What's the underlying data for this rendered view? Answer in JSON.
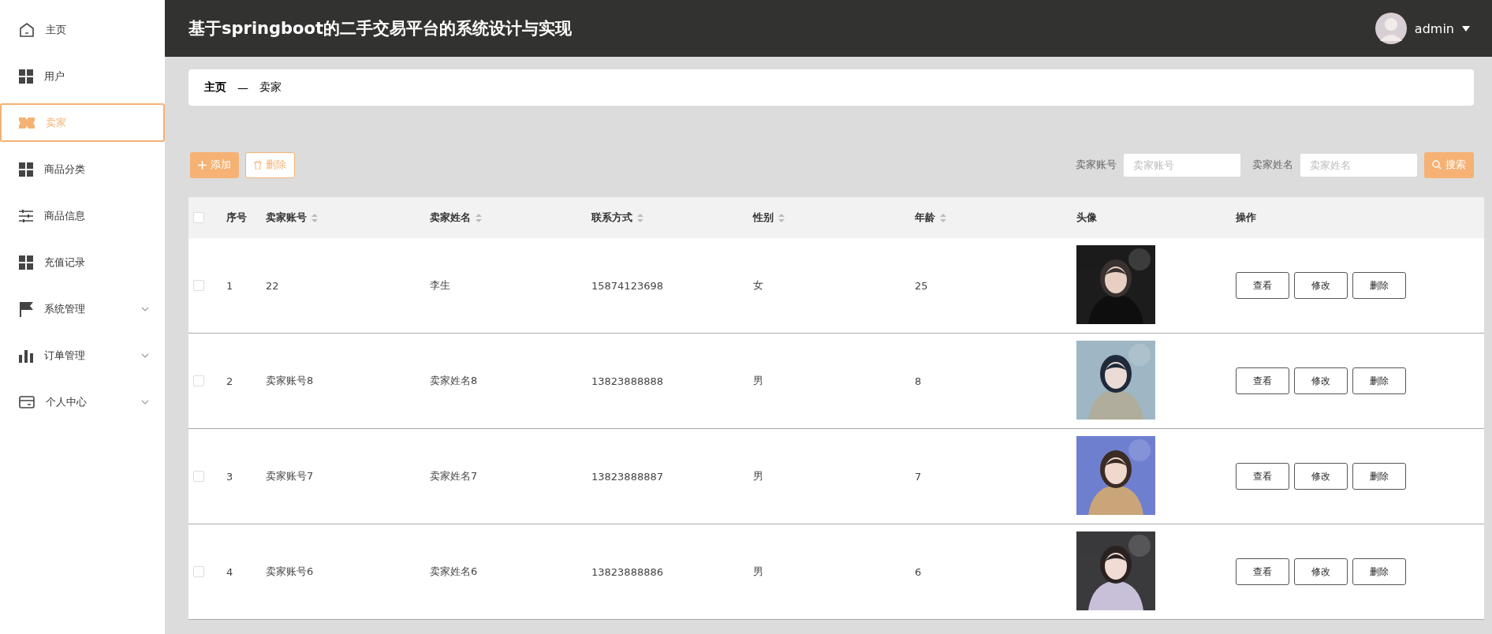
{
  "header": {
    "title": "基于springboot的二手交易平台的系统设计与实现",
    "user": "admin"
  },
  "sidebar": {
    "items": [
      {
        "label": "主页",
        "selected": false,
        "has_submenu": false
      },
      {
        "label": "用户",
        "selected": false,
        "has_submenu": false
      },
      {
        "label": "卖家",
        "selected": true,
        "has_submenu": false
      },
      {
        "label": "商品分类",
        "selected": false,
        "has_submenu": false
      },
      {
        "label": "商品信息",
        "selected": false,
        "has_submenu": false
      },
      {
        "label": "充值记录",
        "selected": false,
        "has_submenu": false
      },
      {
        "label": "系统管理",
        "selected": false,
        "has_submenu": true
      },
      {
        "label": "订单管理",
        "selected": false,
        "has_submenu": true
      },
      {
        "label": "个人中心",
        "selected": false,
        "has_submenu": true
      }
    ]
  },
  "breadcrumb": {
    "items": [
      "主页",
      "卖家"
    ],
    "separator": "—"
  },
  "toolbar": {
    "add_button": "添加",
    "delete_button": "删除",
    "filters": [
      {
        "label": "卖家账号",
        "placeholder": "卖家账号"
      },
      {
        "label": "卖家姓名",
        "placeholder": "卖家姓名"
      }
    ],
    "search_button": "搜索"
  },
  "table": {
    "header_checked": false,
    "columns": [
      {
        "label": "序号",
        "sortable": false
      },
      {
        "label": "卖家账号",
        "sortable": true
      },
      {
        "label": "卖家姓名",
        "sortable": true
      },
      {
        "label": "联系方式",
        "sortable": true
      },
      {
        "label": "性别",
        "sortable": true
      },
      {
        "label": "年龄",
        "sortable": true
      },
      {
        "label": "头像",
        "sortable": false
      },
      {
        "label": "操作",
        "sortable": false
      }
    ],
    "rows": [
      {
        "checked": false,
        "cells": [
          "1",
          "22",
          "李生",
          "15874123698",
          "女",
          "25"
        ],
        "photo": {
          "kind": "picture"
        },
        "actions": [
          "查看",
          "修改",
          "删除"
        ]
      },
      {
        "checked": false,
        "cells": [
          "2",
          "卖家账号8",
          "卖家姓名8",
          "13823888888",
          "男",
          "8"
        ],
        "photo": {
          "kind": "picture"
        },
        "actions": [
          "查看",
          "修改",
          "删除"
        ]
      },
      {
        "checked": false,
        "cells": [
          "3",
          "卖家账号7",
          "卖家姓名7",
          "13823888887",
          "男",
          "7"
        ],
        "photo": {
          "kind": "picture"
        },
        "actions": [
          "查看",
          "修改",
          "删除"
        ]
      },
      {
        "checked": false,
        "cells": [
          "4",
          "卖家账号6",
          "卖家姓名6",
          "13823888886",
          "男",
          "6"
        ],
        "photo": {
          "kind": "picture"
        },
        "actions": [
          "查看",
          "修改",
          "删除"
        ]
      }
    ]
  }
}
